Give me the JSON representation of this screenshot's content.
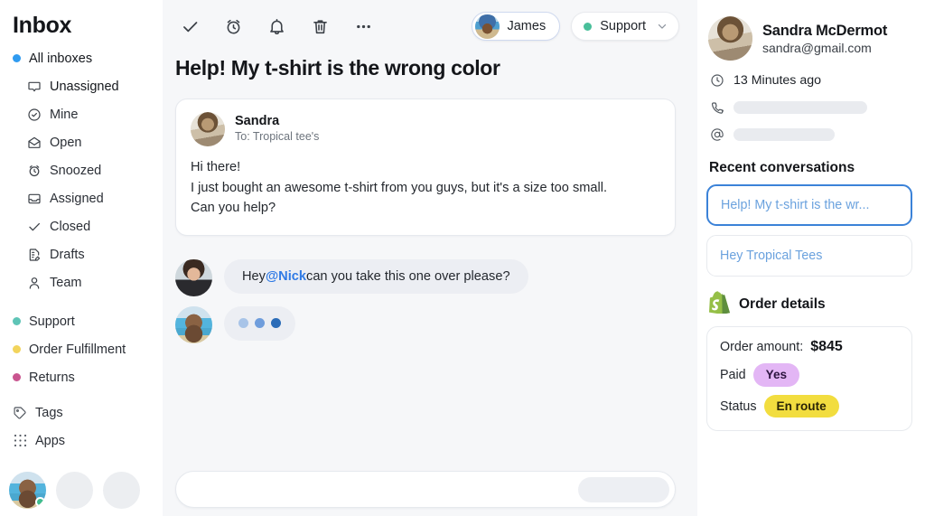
{
  "sidebar": {
    "title": "Inbox",
    "primary": {
      "label": "All inboxes",
      "icon": "blue-dot",
      "color": "#2f9bf0"
    },
    "folders": [
      {
        "label": "Unassigned",
        "icon": "chat-bubble-icon"
      },
      {
        "label": "Mine",
        "icon": "check-circle-icon"
      },
      {
        "label": "Open",
        "icon": "open-envelope-icon"
      },
      {
        "label": "Snoozed",
        "icon": "alarm-clock-icon"
      },
      {
        "label": "Assigned",
        "icon": "inbox-tray-icon"
      },
      {
        "label": "Closed",
        "icon": "check-icon"
      },
      {
        "label": "Drafts",
        "icon": "draft-document-icon"
      },
      {
        "label": "Team",
        "icon": "person-icon"
      }
    ],
    "teams": [
      {
        "label": "Support",
        "color": "#5ec4b6"
      },
      {
        "label": "Order Fulfillment",
        "color": "#f2d45c"
      },
      {
        "label": "Returns",
        "color": "#c9558f"
      }
    ],
    "utilities": [
      {
        "label": "Tags",
        "icon": "tag-icon"
      },
      {
        "label": "Apps",
        "icon": "grid-dots-icon"
      }
    ],
    "avatars": [
      {
        "name": "nick-avatar",
        "online": true
      },
      {
        "name": "placeholder-avatar-1",
        "online": false
      },
      {
        "name": "placeholder-avatar-2",
        "online": false
      }
    ]
  },
  "toolbar": {
    "icons": [
      {
        "name": "close-conversation-icon",
        "label": "check-icon"
      },
      {
        "name": "snooze-icon",
        "label": "alarm-clock-icon"
      },
      {
        "name": "notifications-icon",
        "label": "bell-icon"
      },
      {
        "name": "delete-icon",
        "label": "trash-icon"
      },
      {
        "name": "more-options-icon",
        "label": "ellipsis-icon"
      }
    ],
    "assignee": {
      "label": "James"
    },
    "team": {
      "label": "Support",
      "dot_color": "#49bf9a"
    }
  },
  "conversation": {
    "subject": "Help! My t-shirt is the wrong color",
    "message": {
      "from": "Sandra",
      "to": "To: Tropical tee's",
      "lines": [
        "Hi there!",
        "I just bought an awesome t-shirt from you guys, but it's a size too small.",
        "Can you help?"
      ]
    },
    "replies": [
      {
        "type": "note",
        "text_before": "Hey ",
        "mention": "@Nick",
        "text_after": " can you take this one over please?"
      },
      {
        "type": "typing",
        "dots": [
          "#a8c4e8",
          "#6f9ddc",
          "#2b6cb8"
        ]
      }
    ],
    "composer": {
      "value": "",
      "placeholder": ""
    }
  },
  "contact_panel": {
    "name": "Sandra McDermot",
    "email": "sandra@gmail.com",
    "status_online": true,
    "time_ago": "13 Minutes ago",
    "phone_hidden": "",
    "handle_hidden": "",
    "recent_title": "Recent conversations",
    "recent": [
      {
        "label": "Help! My t-shirt is the wr...",
        "active": true
      },
      {
        "label": "Hey Tropical Tees",
        "active": false
      }
    ],
    "order": {
      "icon": "shopify-icon",
      "title": "Order details",
      "amount_label": "Order amount:",
      "amount_value": "$845",
      "paid_label": "Paid",
      "paid_value": "Yes",
      "status_label": "Status",
      "status_value": "En route"
    }
  }
}
